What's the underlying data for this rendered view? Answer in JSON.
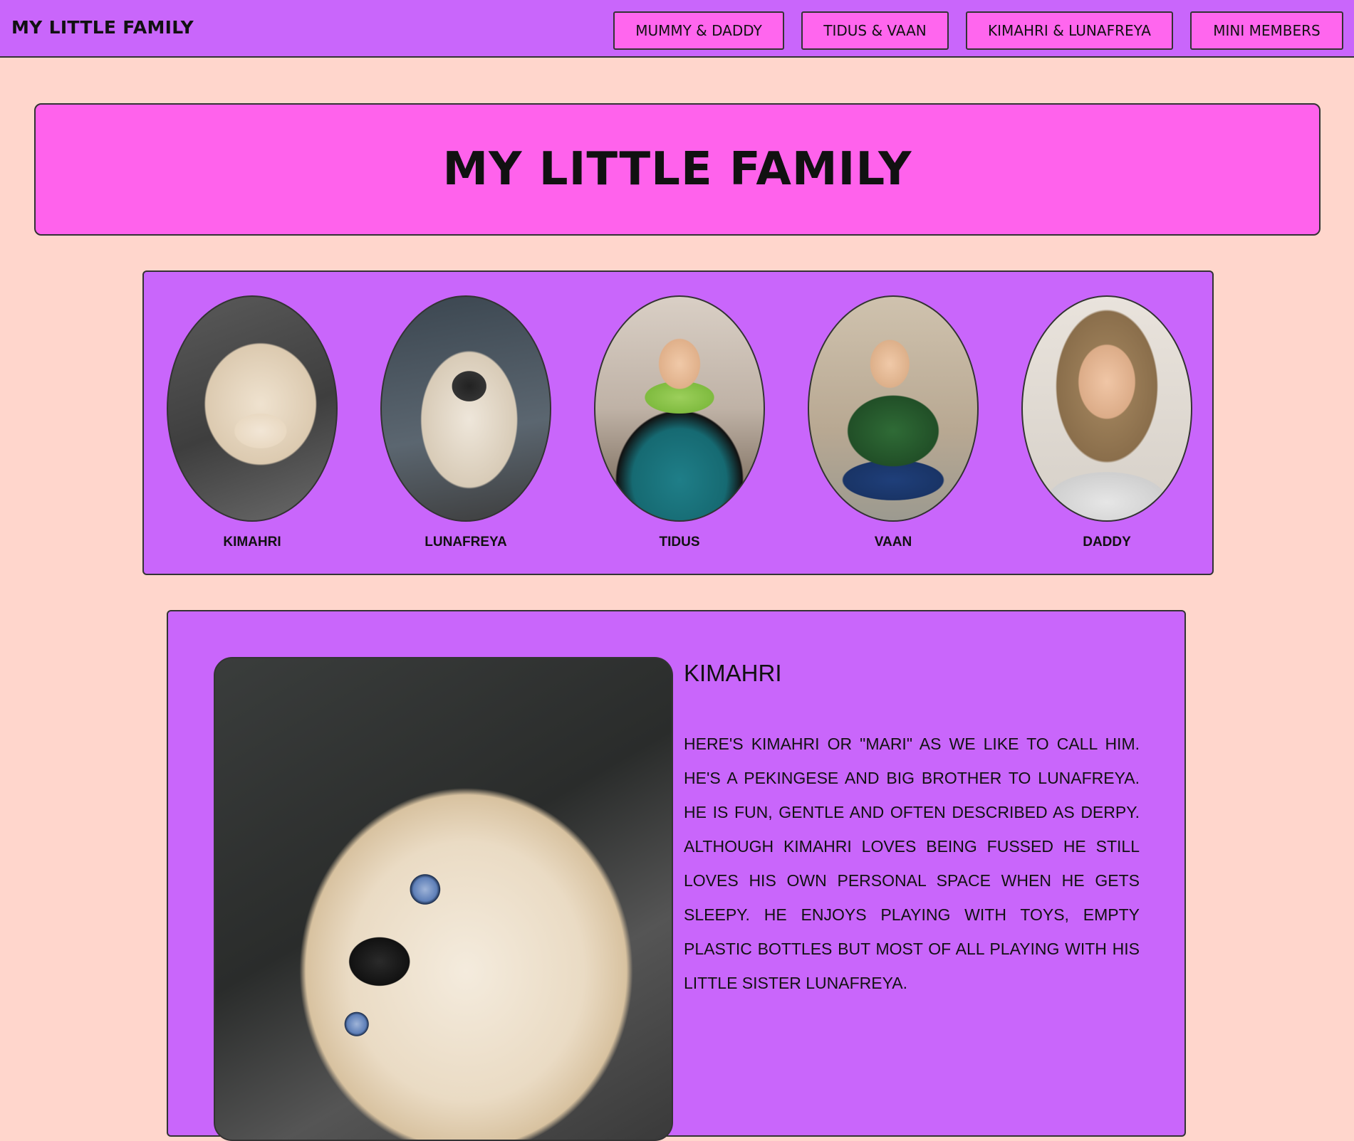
{
  "navbar": {
    "brand": "MY LITTLE FAMILY",
    "links": [
      {
        "label": "MUMMY & DADDY"
      },
      {
        "label": "TIDUS & VAAN"
      },
      {
        "label": "KIMAHRI & LUNAFREYA"
      },
      {
        "label": "MINI MEMBERS"
      }
    ]
  },
  "hero": {
    "title": "MY LITTLE FAMILY"
  },
  "members": [
    {
      "name": "KIMAHRI"
    },
    {
      "name": "LUNAFREYA"
    },
    {
      "name": "TIDUS"
    },
    {
      "name": "VAAN"
    },
    {
      "name": "DADDY"
    }
  ],
  "detail": {
    "title": "KIMAHRI",
    "text": "HERE'S KIMAHRI OR \"MARI\" AS WE LIKE TO CALL HIM. HE'S A PEKINGESE AND BIG BROTHER TO LUNAFREYA. HE IS FUN, GENTLE AND OFTEN DESCRIBED AS DERPY. ALTHOUGH KIMAHRI LOVES BEING FUSSED HE STILL LOVES HIS OWN PERSONAL SPACE WHEN HE GETS SLEEPY. HE ENJOYS PLAYING WITH TOYS, EMPTY PLASTIC BOTTLES BUT MOST OF ALL PLAYING WITH HIS LITTLE SISTER LUNAFREYA."
  },
  "colors": {
    "page_background": "#ffd6cc",
    "purple": "#c966fb",
    "pink": "#ff62ec",
    "border": "#333333"
  }
}
